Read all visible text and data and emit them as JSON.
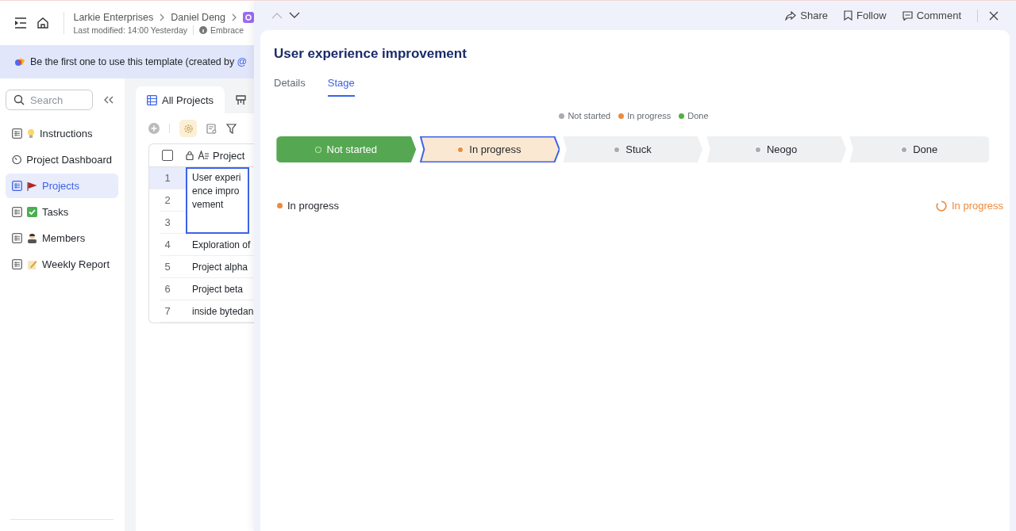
{
  "header": {
    "breadcrumbs": [
      "Larkie Enterprises",
      "Daniel Deng"
    ],
    "modified": "Last modified: 14:00 Yesterday",
    "info": "Embrace"
  },
  "banner": {
    "text": "Be the first one to use this template (created by",
    "mention": "@"
  },
  "sidebar": {
    "search": {
      "placeholder": "Search"
    },
    "items": [
      {
        "label": "Instructions",
        "kind": "bulb",
        "selected": false
      },
      {
        "label": "Project Dashboard",
        "kind": "dashboard",
        "selected": false
      },
      {
        "label": "Projects",
        "kind": "flag",
        "selected": true
      },
      {
        "label": "Tasks",
        "kind": "check",
        "selected": false
      },
      {
        "label": "Members",
        "kind": "person",
        "selected": false
      },
      {
        "label": "Weekly Report",
        "kind": "memo",
        "selected": false
      }
    ]
  },
  "view_tabs": [
    {
      "label": "All Projects",
      "selected": true
    },
    {
      "selected": false
    }
  ],
  "table": {
    "column": "Project",
    "all_checked": false,
    "rows": [
      {
        "number": "1",
        "project": "User experience improvement",
        "selected": true
      },
      {
        "number": "2",
        "selected": false
      },
      {
        "number": "3",
        "selected": false
      },
      {
        "number": "4",
        "project": "Exploration of",
        "selected": false
      },
      {
        "number": "5",
        "project": "Project alpha",
        "selected": false
      },
      {
        "number": "6",
        "project": "Project beta",
        "selected": false
      },
      {
        "number": "7",
        "project": "inside bytedan",
        "selected": false
      }
    ]
  },
  "panel": {
    "actions": [
      "Share",
      "Follow",
      "Comment"
    ],
    "title": "User experience improvement",
    "tabs": [
      {
        "label": "Details",
        "selected": false
      },
      {
        "label": "Stage",
        "selected": true
      }
    ],
    "legend": [
      {
        "label": "Not started",
        "color": "#a9abb0"
      },
      {
        "label": "In progress",
        "color": "#ee8a3c"
      },
      {
        "label": "Done",
        "color": "#52b043"
      }
    ],
    "stages": [
      {
        "label": "Not started",
        "completed": true,
        "selected": false,
        "color": "#52b043"
      },
      {
        "label": "In progress",
        "completed": false,
        "selected": true,
        "color": "#ee8a3c"
      },
      {
        "label": "Stuck",
        "completed": false,
        "selected": false,
        "color": "#a9abb0"
      },
      {
        "label": "Neogo",
        "completed": false,
        "selected": false,
        "color": "#a9abb0"
      },
      {
        "label": "Done",
        "completed": false,
        "selected": false,
        "color": "#a9abb0"
      }
    ],
    "current": {
      "label": "In progress",
      "color": "#ee8a3c",
      "status": "In progress"
    }
  }
}
